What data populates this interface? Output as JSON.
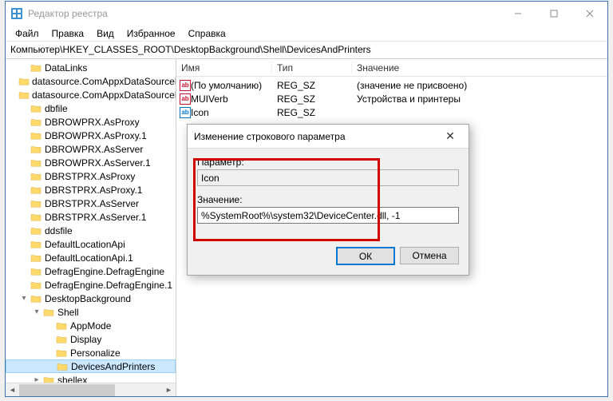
{
  "window": {
    "title": "Редактор реестра"
  },
  "menu": {
    "file": "Файл",
    "edit": "Правка",
    "view": "Вид",
    "favorites": "Избранное",
    "help": "Справка"
  },
  "address": "Компьютер\\HKEY_CLASSES_ROOT\\DesktopBackground\\Shell\\DevicesAndPrinters",
  "columns": {
    "name": "Имя",
    "type": "Тип",
    "value": "Значение"
  },
  "values": [
    {
      "icon": "str",
      "name": "(По умолчанию)",
      "type": "REG_SZ",
      "data": "(значение не присвоено)"
    },
    {
      "icon": "str",
      "name": "MUIVerb",
      "type": "REG_SZ",
      "data": "Устройства и принтеры"
    },
    {
      "icon": "bin",
      "name": "Icon",
      "type": "REG_SZ",
      "data": ""
    }
  ],
  "tree": [
    {
      "indent": 1,
      "exp": "",
      "label": "DataLinks"
    },
    {
      "indent": 1,
      "exp": "",
      "label": "datasource.ComAppxDataSourceP"
    },
    {
      "indent": 1,
      "exp": "",
      "label": "datasource.ComAppxDataSourceP"
    },
    {
      "indent": 1,
      "exp": "",
      "label": "dbfile"
    },
    {
      "indent": 1,
      "exp": "",
      "label": "DBROWPRX.AsProxy"
    },
    {
      "indent": 1,
      "exp": "",
      "label": "DBROWPRX.AsProxy.1"
    },
    {
      "indent": 1,
      "exp": "",
      "label": "DBROWPRX.AsServer"
    },
    {
      "indent": 1,
      "exp": "",
      "label": "DBROWPRX.AsServer.1"
    },
    {
      "indent": 1,
      "exp": "",
      "label": "DBRSTPRX.AsProxy"
    },
    {
      "indent": 1,
      "exp": "",
      "label": "DBRSTPRX.AsProxy.1"
    },
    {
      "indent": 1,
      "exp": "",
      "label": "DBRSTPRX.AsServer"
    },
    {
      "indent": 1,
      "exp": "",
      "label": "DBRSTPRX.AsServer.1"
    },
    {
      "indent": 1,
      "exp": "",
      "label": "ddsfile"
    },
    {
      "indent": 1,
      "exp": "",
      "label": "DefaultLocationApi"
    },
    {
      "indent": 1,
      "exp": "",
      "label": "DefaultLocationApi.1"
    },
    {
      "indent": 1,
      "exp": "",
      "label": "DefragEngine.DefragEngine"
    },
    {
      "indent": 1,
      "exp": "",
      "label": "DefragEngine.DefragEngine.1"
    },
    {
      "indent": 1,
      "exp": "▾",
      "label": "DesktopBackground"
    },
    {
      "indent": 2,
      "exp": "▾",
      "label": "Shell"
    },
    {
      "indent": 3,
      "exp": "",
      "label": "AppMode"
    },
    {
      "indent": 3,
      "exp": "",
      "label": "Display"
    },
    {
      "indent": 3,
      "exp": "",
      "label": "Personalize"
    },
    {
      "indent": 3,
      "exp": "",
      "label": "DevicesAndPrinters",
      "selected": true
    },
    {
      "indent": 2,
      "exp": "▸",
      "label": "shellex"
    }
  ],
  "dialog": {
    "title": "Изменение строкового параметра",
    "param_label": "Параметр:",
    "param_value": "Icon",
    "value_label": "Значение:",
    "value_value": "%SystemRoot%\\system32\\DeviceCenter.dll, -1",
    "ok": "ОК",
    "cancel": "Отмена"
  }
}
